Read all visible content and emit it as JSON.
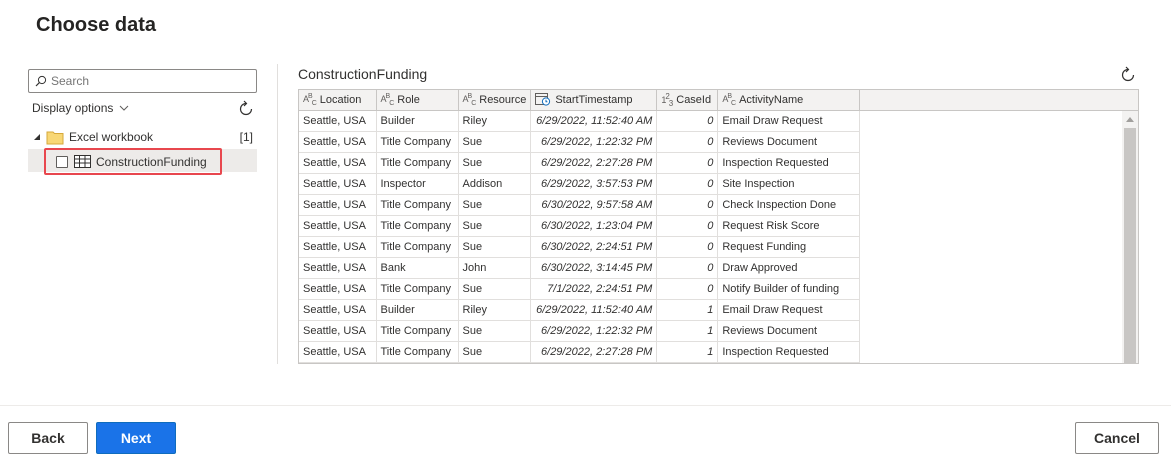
{
  "page": {
    "title": "Choose data"
  },
  "navigator": {
    "search_placeholder": "Search",
    "display_options_label": "Display options",
    "workbook": {
      "label": "Excel workbook",
      "count": "[1]"
    },
    "item": {
      "label": "ConstructionFunding"
    }
  },
  "preview": {
    "title": "ConstructionFunding",
    "columns": [
      {
        "type_icon": "ABC",
        "name": "Location"
      },
      {
        "type_icon": "ABC",
        "name": "Role"
      },
      {
        "type_icon": "ABC",
        "name": "Resource"
      },
      {
        "type_icon": "datetime",
        "name": "StartTimestamp"
      },
      {
        "type_icon": "123",
        "name": "CaseId"
      },
      {
        "type_icon": "ABC",
        "name": "ActivityName"
      }
    ],
    "rows": [
      [
        "Seattle, USA",
        "Builder",
        "Riley",
        "6/29/2022, 11:52:40 AM",
        "0",
        "Email Draw Request"
      ],
      [
        "Seattle, USA",
        "Title Company",
        "Sue",
        "6/29/2022, 1:22:32 PM",
        "0",
        "Reviews Document"
      ],
      [
        "Seattle, USA",
        "Title Company",
        "Sue",
        "6/29/2022, 2:27:28 PM",
        "0",
        "Inspection Requested"
      ],
      [
        "Seattle, USA",
        "Inspector",
        "Addison",
        "6/29/2022, 3:57:53 PM",
        "0",
        "Site Inspection"
      ],
      [
        "Seattle, USA",
        "Title Company",
        "Sue",
        "6/30/2022, 9:57:58 AM",
        "0",
        "Check Inspection Done"
      ],
      [
        "Seattle, USA",
        "Title Company",
        "Sue",
        "6/30/2022, 1:23:04 PM",
        "0",
        "Request Risk Score"
      ],
      [
        "Seattle, USA",
        "Title Company",
        "Sue",
        "6/30/2022, 2:24:51 PM",
        "0",
        "Request Funding"
      ],
      [
        "Seattle, USA",
        "Bank",
        "John",
        "6/30/2022, 3:14:45 PM",
        "0",
        "Draw Approved"
      ],
      [
        "Seattle, USA",
        "Title Company",
        "Sue",
        "7/1/2022, 2:24:51 PM",
        "0",
        "Notify Builder of funding"
      ],
      [
        "Seattle, USA",
        "Builder",
        "Riley",
        "6/29/2022, 11:52:40 AM",
        "1",
        "Email Draw Request"
      ],
      [
        "Seattle, USA",
        "Title Company",
        "Sue",
        "6/29/2022, 1:22:32 PM",
        "1",
        "Reviews Document"
      ],
      [
        "Seattle, USA",
        "Title Company",
        "Sue",
        "6/29/2022, 2:27:28 PM",
        "1",
        "Inspection Requested"
      ]
    ]
  },
  "footer": {
    "back_label": "Back",
    "next_label": "Next",
    "cancel_label": "Cancel"
  },
  "colors": {
    "accent": "#1a73e8",
    "highlight_border": "#e8474e"
  }
}
